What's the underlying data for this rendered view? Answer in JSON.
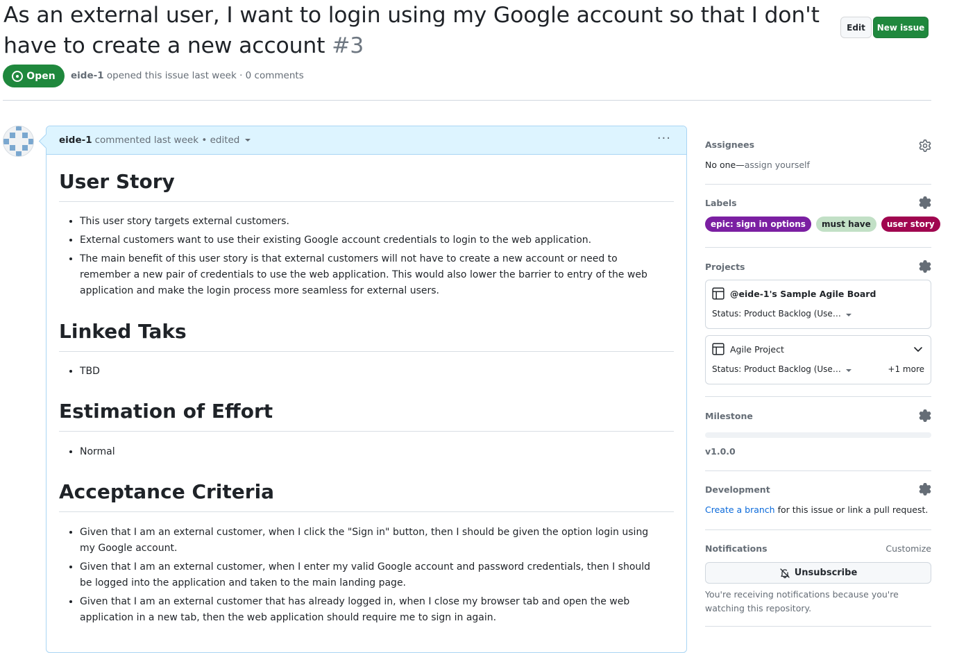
{
  "issue": {
    "title": "As an external user, I want to login using my Google account so that I don't have to create a new account",
    "number": "#3",
    "state": "Open",
    "author": "eide-1",
    "opened_text": "opened this issue last week",
    "separator": "·",
    "comments_count": "0 comments"
  },
  "header_buttons": {
    "edit": "Edit",
    "new_issue": "New issue"
  },
  "comment": {
    "author": "eide-1",
    "meta": "commented last week • edited",
    "menu": "···",
    "sections": [
      {
        "heading": "User Story",
        "items": [
          "This user story targets external customers.",
          "External customers want to use their existing Google account credentials to login to the web application.",
          "The main benefit of this user story is that external customers will not have to create a new account or need to remember a new pair of credentials to use the web application. This would also lower the barrier to entry of the web application and make the login process more seamless for external users."
        ]
      },
      {
        "heading": "Linked Taks",
        "items": [
          "TBD"
        ]
      },
      {
        "heading": "Estimation of Effort",
        "items": [
          "Normal"
        ]
      },
      {
        "heading": "Acceptance Criteria",
        "items": [
          "Given that I am an external customer, when I click the \"Sign in\" button, then I should be given the option login using my Google account.",
          "Given that I am an external customer, when I enter my valid Google account and password credentials, then I should be logged into the application and taken to the main landing page.",
          "Given that I am an external customer that has already logged in, when I close my browser tab and open the web application in a new tab, then the web application should require me to sign in again."
        ]
      }
    ]
  },
  "sidebar": {
    "assignees": {
      "title": "Assignees",
      "value": "No one—",
      "assign": "assign yourself"
    },
    "labels": {
      "title": "Labels",
      "items": [
        {
          "name": "epic: sign in options",
          "bg": "#7b1fa2",
          "fg": "#ffffff"
        },
        {
          "name": "must have",
          "bg": "#c2e0c6",
          "fg": "#1f2328"
        },
        {
          "name": "user story",
          "bg": "#a0064f",
          "fg": "#ffffff"
        }
      ]
    },
    "projects": {
      "title": "Projects",
      "items": [
        {
          "name": "@eide-1's Sample Agile Board",
          "status": "Status: Product Backlog (Use…",
          "more": ""
        },
        {
          "name": "Agile Project",
          "status": "Status: Product Backlog (Use…",
          "more": "+1 more"
        }
      ]
    },
    "milestone": {
      "title": "Milestone",
      "name": "v1.0.0",
      "progress": 0
    },
    "development": {
      "title": "Development",
      "link": "Create a branch",
      "text": " for this issue or link a pull request."
    },
    "notifications": {
      "title": "Notifications",
      "customize": "Customize",
      "button": "Unsubscribe",
      "note": "You're receiving notifications because you're watching this repository."
    }
  },
  "colors": {
    "open": "#1f883d",
    "link": "#0969da",
    "comment_header": "#ddf4ff"
  }
}
